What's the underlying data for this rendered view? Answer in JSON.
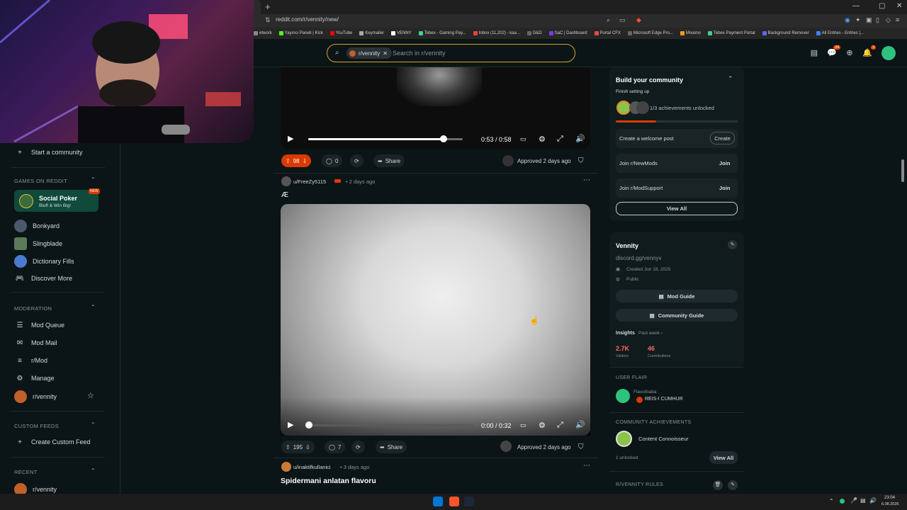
{
  "browser": {
    "url": "reddit.com/r/vennity/new/",
    "new_tab_glyph": "+",
    "window_controls": [
      "—",
      "▢",
      "✕"
    ],
    "bookmarks": [
      "etwork",
      "Yayıncı Paneli | Kick",
      "YouTube",
      "Keymailer",
      "VENNY",
      "Tebex - Gaming Pay...",
      "Inbox (11,202) - kaa...",
      "D&D",
      "SaC | Dashboard",
      "Portal CFX",
      "Microsoft Edge Pro...",
      "Mixamo",
      "Tebex Payment Portal",
      "Background Remover",
      "All Entries - Entries |..."
    ]
  },
  "header": {
    "community_chip": "r/vennity",
    "search_placeholder": "Search in r/vennity",
    "chat_badge": "34",
    "notif_badge": "3"
  },
  "sidebar": {
    "start_community": "Start a community",
    "games_section": "GAMES ON REDDIT",
    "poker_title": "Social Poker",
    "poker_sub": "Bluff & Win Big!",
    "poker_badge": "NEW",
    "games": [
      "Bonkyard",
      "Slingblade",
      "Dictionary Fills",
      "Discover More"
    ],
    "moderation_section": "MODERATION",
    "moderation": [
      "Mod Queue",
      "Mod Mail",
      "r/Mod",
      "Manage",
      "r/vennity"
    ],
    "custom_feeds_section": "CUSTOM FEEDS",
    "create_custom_feed": "Create Custom Feed",
    "recent_section": "RECENT",
    "recent": [
      "r/vennity"
    ]
  },
  "post1": {
    "time": "0:53 / 0:58",
    "progress": 0.87,
    "votes": "98",
    "comments": "0",
    "share": "Share",
    "approved": "Approved 2 days ago"
  },
  "post2": {
    "author": "u/FreeZy5115",
    "age": "• 2 days ago",
    "title": "Æ",
    "time": "0:00 / 0:32",
    "progress": 0.0,
    "votes": "195",
    "comments": "7",
    "share": "Share",
    "approved": "Approved 2 days ago"
  },
  "post3": {
    "author": "u/inaktifkullanici",
    "age": "• 3 days ago",
    "title": "Spidermani anlatan flavoru"
  },
  "right": {
    "build_title": "Build your community",
    "build_sub": "Finish setting up",
    "achievements": "1/3 achievements unlocked",
    "build_progress": 0.33,
    "welcome_post": "Create a welcome post",
    "create": "Create",
    "join_newmods": "Join r/NewMods",
    "join_modsupport": "Join r/ModSupport",
    "join": "Join",
    "view_all": "View All",
    "community_name": "Vennity",
    "discord": "discord.gg/vennyv",
    "created": "Created Jun 18, 2025",
    "visibility": "Public",
    "mod_guide": "Mod Guide",
    "community_guide": "Community Guide",
    "insights": "Insights",
    "insights_period": "Past week ›",
    "visitors_value": "2.7K",
    "visitors_label": "Visitors",
    "contrib_value": "46",
    "contrib_label": "Contributions",
    "user_flair_section": "USER FLAIR",
    "flair_user": "Flavorbaba",
    "flair_text": "REIS-I CUMHUR",
    "achievements_section": "COMMUNITY ACHIEVEMENTS",
    "achievement_name": "Content Connoisseur",
    "unlocked": "1 unlocked",
    "view_all_2": "View All",
    "rules_section": "R/VENNITY RULES"
  },
  "taskbar": {
    "time": "23:04",
    "date": "6.08.2026"
  },
  "colors": {
    "accent": "#ff4500",
    "background": "#0b1416",
    "search_border": "#d3a51f",
    "visitors": "#ff6a55"
  }
}
